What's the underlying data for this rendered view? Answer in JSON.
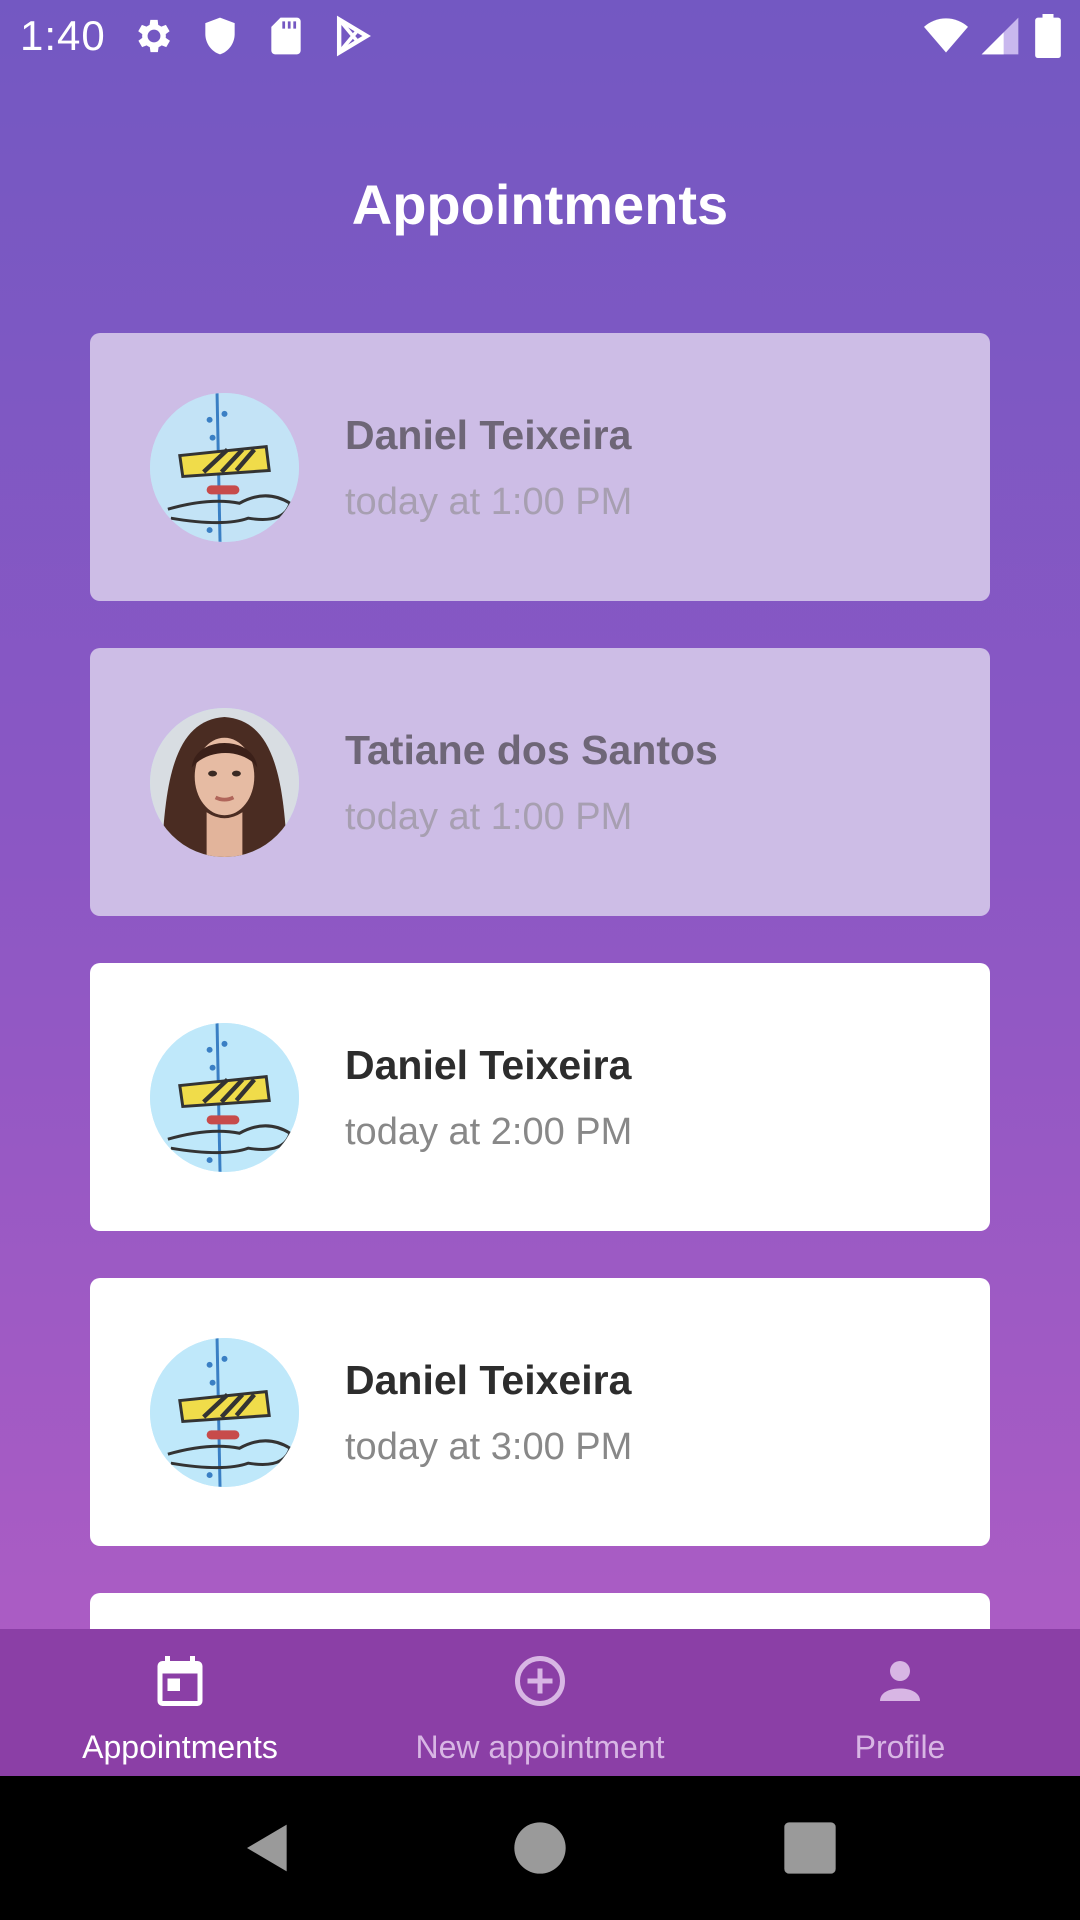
{
  "status_bar": {
    "time": "1:40",
    "left_icons": [
      "settings-icon",
      "shield-icon",
      "sd-card-icon",
      "play-store-icon"
    ],
    "right_icons": [
      "wifi-icon",
      "cell-signal-icon",
      "battery-icon"
    ]
  },
  "header": {
    "title": "Appointments"
  },
  "appointments": [
    {
      "name": "Daniel Teixeira",
      "time": "today at 1:00 PM",
      "avatar": "barber-pole-icon",
      "past": true
    },
    {
      "name": "Tatiane dos Santos",
      "time": "today at 1:00 PM",
      "avatar": "user-photo",
      "past": true
    },
    {
      "name": "Daniel Teixeira",
      "time": "today at 2:00 PM",
      "avatar": "barber-pole-icon",
      "past": false
    },
    {
      "name": "Daniel Teixeira",
      "time": "today at 3:00 PM",
      "avatar": "barber-pole-icon",
      "past": false
    }
  ],
  "bottom_nav": {
    "items": [
      {
        "label": "Appointments",
        "icon": "calendar-icon",
        "active": true
      },
      {
        "label": "New appointment",
        "icon": "add-circle-icon",
        "active": false
      },
      {
        "label": "Profile",
        "icon": "person-icon",
        "active": false
      }
    ]
  },
  "system_nav": [
    "back-icon",
    "home-icon",
    "recents-icon"
  ],
  "colors": {
    "gradient_top": "#7358c2",
    "gradient_bottom": "#b05fc3",
    "past_card": "#cdbde6",
    "bottom_nav_bg": "#8b3fa6",
    "nav_inactive": "#d8b6e4"
  }
}
